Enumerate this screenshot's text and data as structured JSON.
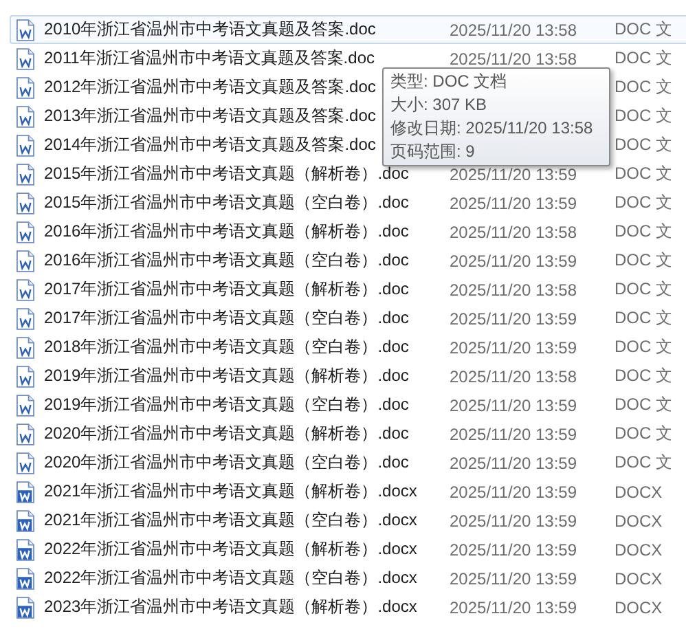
{
  "files": [
    {
      "name": "2010年浙江省温州市中考语文真题及答案.doc",
      "kind": "doc",
      "selected": true,
      "date": "2025/11/20 13:58",
      "type": "DOC 文"
    },
    {
      "name": "2011年浙江省温州市中考语文真题及答案.doc",
      "kind": "doc",
      "selected": false,
      "date": "2025/11/20 13:58",
      "type": "DOC 文"
    },
    {
      "name": "2012年浙江省温州市中考语文真题及答案.doc",
      "kind": "doc",
      "selected": false,
      "type": "DOC 文"
    },
    {
      "name": "2013年浙江省温州市中考语文真题及答案.doc",
      "kind": "doc",
      "selected": false,
      "type": "DOC 文"
    },
    {
      "name": "2014年浙江省温州市中考语文真题及答案.doc",
      "kind": "doc",
      "selected": false,
      "type": "DOC 文"
    },
    {
      "name": "2015年浙江省温州市中考语文真题（解析卷）.doc",
      "kind": "doc",
      "selected": false,
      "date": "2025/11/20 13:59",
      "type": "DOC 文"
    },
    {
      "name": "2015年浙江省温州市中考语文真题（空白卷）.doc",
      "kind": "doc",
      "selected": false,
      "date": "2025/11/20 13:59",
      "type": "DOC 文"
    },
    {
      "name": "2016年浙江省温州市中考语文真题（解析卷）.doc",
      "kind": "doc",
      "selected": false,
      "date": "2025/11/20 13:58",
      "type": "DOC 文"
    },
    {
      "name": "2016年浙江省温州市中考语文真题（空白卷）.doc",
      "kind": "doc",
      "selected": false,
      "date": "2025/11/20 13:59",
      "type": "DOC 文"
    },
    {
      "name": "2017年浙江省温州市中考语文真题（解析卷）.doc",
      "kind": "doc",
      "selected": false,
      "date": "2025/11/20 13:58",
      "type": "DOC 文"
    },
    {
      "name": "2017年浙江省温州市中考语文真题（空白卷）.doc",
      "kind": "doc",
      "selected": false,
      "date": "2025/11/20 13:59",
      "type": "DOC 文"
    },
    {
      "name": "2018年浙江省温州市中考语文真题（空白卷）.doc",
      "kind": "doc",
      "selected": false,
      "date": "2025/11/20 13:59",
      "type": "DOC 文"
    },
    {
      "name": "2019年浙江省温州市中考语文真题（解析卷）.doc",
      "kind": "doc",
      "selected": false,
      "date": "2025/11/20 13:58",
      "type": "DOC 文"
    },
    {
      "name": "2019年浙江省温州市中考语文真题（空白卷）.doc",
      "kind": "doc",
      "selected": false,
      "date": "2025/11/20 13:59",
      "type": "DOC 文"
    },
    {
      "name": "2020年浙江省温州市中考语文真题（解析卷）.doc",
      "kind": "doc",
      "selected": false,
      "date": "2025/11/20 13:59",
      "type": "DOC 文"
    },
    {
      "name": "2020年浙江省温州市中考语文真题（空白卷）.doc",
      "kind": "doc",
      "selected": false,
      "date": "2025/11/20 13:59",
      "type": "DOC 文"
    },
    {
      "name": "2021年浙江省温州市中考语文真题（解析卷）.docx",
      "kind": "docx",
      "selected": false,
      "date": "2025/11/20 13:59",
      "type": "DOCX"
    },
    {
      "name": "2021年浙江省温州市中考语文真题（空白卷）.docx",
      "kind": "docx",
      "selected": false,
      "date": "2025/11/20 13:59",
      "type": "DOCX"
    },
    {
      "name": "2022年浙江省温州市中考语文真题（解析卷）.docx",
      "kind": "docx",
      "selected": false,
      "date": "2025/11/20 13:59",
      "type": "DOCX"
    },
    {
      "name": "2022年浙江省温州市中考语文真题（空白卷）.docx",
      "kind": "docx",
      "selected": false,
      "date": "2025/11/20 13:59",
      "type": "DOCX"
    },
    {
      "name": "2023年浙江省温州市中考语文真题（解析卷）.docx",
      "kind": "docx",
      "selected": false,
      "date": "2025/11/20 13:59",
      "type": "DOCX"
    }
  ],
  "tooltip": {
    "lines": [
      "类型: DOC 文档",
      "大小: 307 KB",
      "修改日期: 2025/11/20 13:58",
      "页码范围: 9"
    ]
  }
}
